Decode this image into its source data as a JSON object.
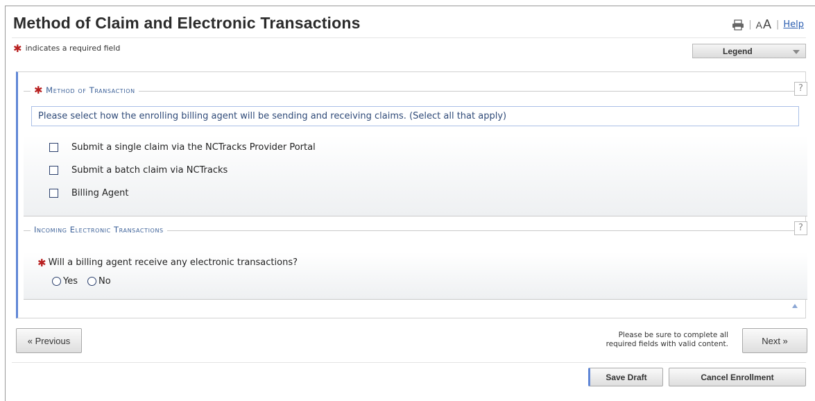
{
  "page": {
    "title": "Method of Claim and Electronic Transactions",
    "required_note": "indicates a required field",
    "required_mark": "✱"
  },
  "tools": {
    "print_icon": "printer-icon",
    "font_size_small": "A",
    "font_size_large": "A",
    "help_label": "Help",
    "separator": "|"
  },
  "legend": {
    "label": "Legend"
  },
  "method_section": {
    "title": "Method of Transaction",
    "help": "?",
    "instructions": "Please select how the enrolling billing agent will be sending and receiving claims. (Select all that apply)",
    "options": [
      {
        "label": "Submit a single claim via the NCTracks Provider Portal",
        "checked": false
      },
      {
        "label": "Submit a batch claim via NCTracks",
        "checked": false
      },
      {
        "label": "Billing Agent",
        "checked": false
      }
    ]
  },
  "incoming_section": {
    "title": "Incoming Electronic Transactions",
    "help": "?",
    "question": "Will a billing agent receive any electronic transactions?",
    "options": [
      {
        "label": "Yes",
        "selected": false
      },
      {
        "label": "No",
        "selected": false
      }
    ]
  },
  "nav": {
    "previous_label": "« Previous",
    "next_label": "Next »",
    "complete_note_line1": "Please be sure to complete all",
    "complete_note_line2": "required fields with valid content."
  },
  "actions": {
    "save_draft_label": "Save Draft",
    "cancel_enrollment_label": "Cancel Enrollment"
  },
  "colors": {
    "accent": "#5f86d6",
    "required": "#b81f1f",
    "section_title": "#3a5f97",
    "link": "#2a5db0"
  }
}
